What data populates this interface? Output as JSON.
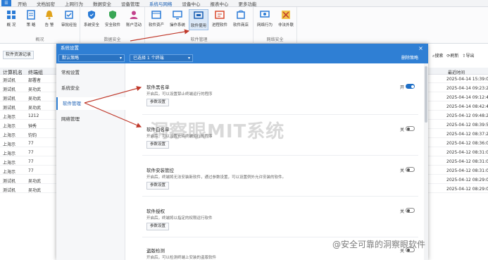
{
  "menubar": {
    "items": [
      "开始",
      "文档加密",
      "上网行为",
      "数据安全",
      "设备管理",
      "系统与网络",
      "设备中心",
      "报表中心",
      "更多功能"
    ]
  },
  "ribbon": {
    "groups": [
      {
        "name": "概况",
        "buttons": [
          "概 况",
          "策 略",
          "告 警",
          "审批经验"
        ]
      },
      {
        "name": "数据安全",
        "buttons": [
          "系统安全",
          "安全软件",
          "账户活动"
        ]
      },
      {
        "name": "软件管理",
        "buttons": [
          "软件资产",
          "操作系统",
          "软件使用",
          "进程软件",
          "软件商店"
        ]
      },
      {
        "name": "网络安全",
        "buttons": [
          "网络行为",
          "非法外联"
        ]
      }
    ],
    "selected_button": "软件使用"
  },
  "background": {
    "toolbar_left": "软件资源记录",
    "col1_header": "计算机名",
    "col2_header": "终端组",
    "rows": [
      [
        "测试机",
        "部署者"
      ],
      [
        "测试机",
        "吴功武"
      ],
      [
        "测试机",
        "吴功武"
      ],
      [
        "测试机",
        "吴功武"
      ],
      [
        "上海示",
        "1212"
      ],
      [
        "上海示",
        "钟秀"
      ],
      [
        "上海示",
        "钧钧"
      ],
      [
        "上海示",
        "77"
      ],
      [
        "上海示",
        "77"
      ],
      [
        "上海示",
        "77"
      ],
      [
        "上海示",
        "77"
      ],
      [
        "测试机",
        "吴功武"
      ],
      [
        "测试机",
        "吴功武"
      ]
    ],
    "right_toolbar": [
      "搜索",
      "刷新",
      "导出"
    ],
    "right_header": "最近时间",
    "right_rows": [
      "2025-04-14 15:39:06",
      "2025-04-14 09:23:20",
      "2025-04-14 09:12:49",
      "2025-04-14 08:42:49",
      "2025-04-12 09:48:26",
      "2025-04-12 08:39:59",
      "2025-04-12 08:37:25",
      "2025-04-12 08:36:08",
      "2025-04-12 08:31:07",
      "2025-04-12 08:31:07",
      "2025-04-12 08:31:06",
      "2025-04-12 08:29:04",
      "2025-04-12 08:29:03"
    ]
  },
  "dialog": {
    "title": "系统设置",
    "close_symbol": "×",
    "scope_select": "默认策略",
    "count_select": "已选择 1 个终端",
    "delete_label": "删除策略",
    "nav": [
      "常规设置",
      "系统安全",
      "软件管理",
      "网络管理"
    ],
    "nav_active_index": 2,
    "sections": [
      {
        "title": "软件黑名单",
        "desc": "开启后，可以设置禁止终端运行的程序",
        "button": "参数设置",
        "state": "开",
        "on": true
      },
      {
        "title": "软件白名单",
        "desc": "开启后，可以设置允许终端运行的程序",
        "button": "参数设置",
        "state": "关",
        "on": false
      },
      {
        "title": "软件安装管控",
        "desc": "开启后，终端将无法安装新软件，通过参数设置，可以设置例外允许安装的软件。",
        "button": "参数设置",
        "state": "关",
        "on": false
      },
      {
        "title": "软件授权",
        "desc": "开启后，终端将以指定的权限运行软件",
        "button": "参数设置",
        "state": "关",
        "on": false
      },
      {
        "title": "盗版检测",
        "desc": "开启后，可以检测终端上安装的盗版软件",
        "button": "",
        "state": "关",
        "on": false
      }
    ]
  },
  "overlays": {
    "watermark": "洞察眼MIT系统",
    "credit": "@安全可靠的洞察眼软件",
    "arrow_color": "#c0392b"
  },
  "colors": {
    "accent": "#2f7fd4",
    "toggle_on": "#1f6fc6"
  }
}
